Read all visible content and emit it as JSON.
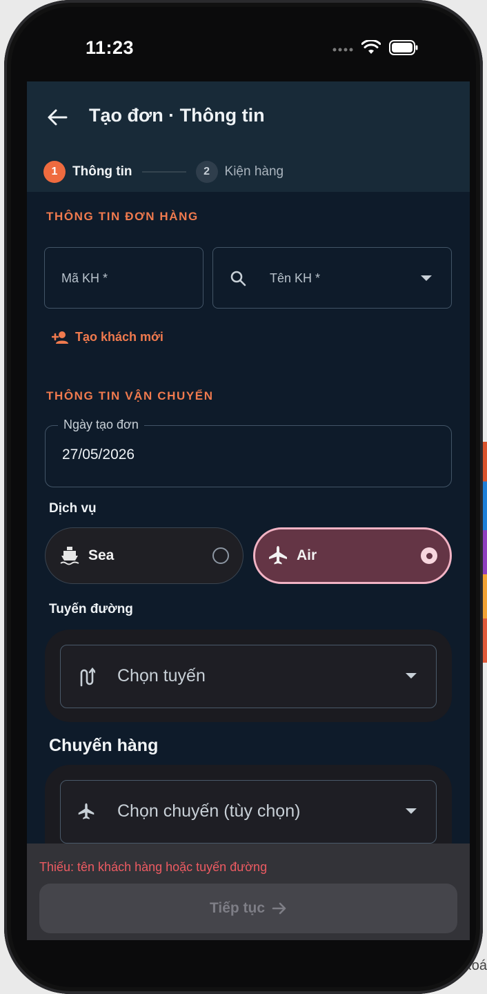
{
  "status_bar": {
    "time": "11:23"
  },
  "appbar": {
    "title": "Tạo đơn · Thông tin"
  },
  "stepper": {
    "steps": [
      {
        "number": "1",
        "label": "Thông tin",
        "active": true
      },
      {
        "number": "2",
        "label": "Kiện hàng",
        "active": false
      }
    ]
  },
  "order_section": {
    "title": "THÔNG TIN ĐƠN HÀNG",
    "customer_code_placeholder": "Mã KH *",
    "customer_name_placeholder": "Tên KH *",
    "new_customer_link": "Tạo khách mới"
  },
  "shipping_section": {
    "title": "THÔNG TIN VẬN CHUYỂN",
    "date_label": "Ngày tạo đơn",
    "date_value": "27/05/2026",
    "service_label": "Dịch vụ",
    "services": [
      {
        "label": "Sea",
        "icon": "ship-icon",
        "selected": false
      },
      {
        "label": "Air",
        "icon": "plane-icon",
        "selected": true
      }
    ],
    "route_label": "Tuyến đường",
    "route_placeholder": "Chọn tuyến",
    "shipment_heading": "Chuyến hàng",
    "shipment_placeholder": "Chọn chuyến (tùy chọn)"
  },
  "footer": {
    "warning": "Thiếu: tên khách hàng hoặc tuyến đường",
    "next_label": "Tiếp tục"
  },
  "background_peek": {
    "text": "Xoá"
  },
  "colors": {
    "accent": "#ef6b3f",
    "error": "#ee5b62",
    "selected_pill": "#643545",
    "appbar": "#182a38",
    "screen_bg": "#0e1b2a"
  }
}
